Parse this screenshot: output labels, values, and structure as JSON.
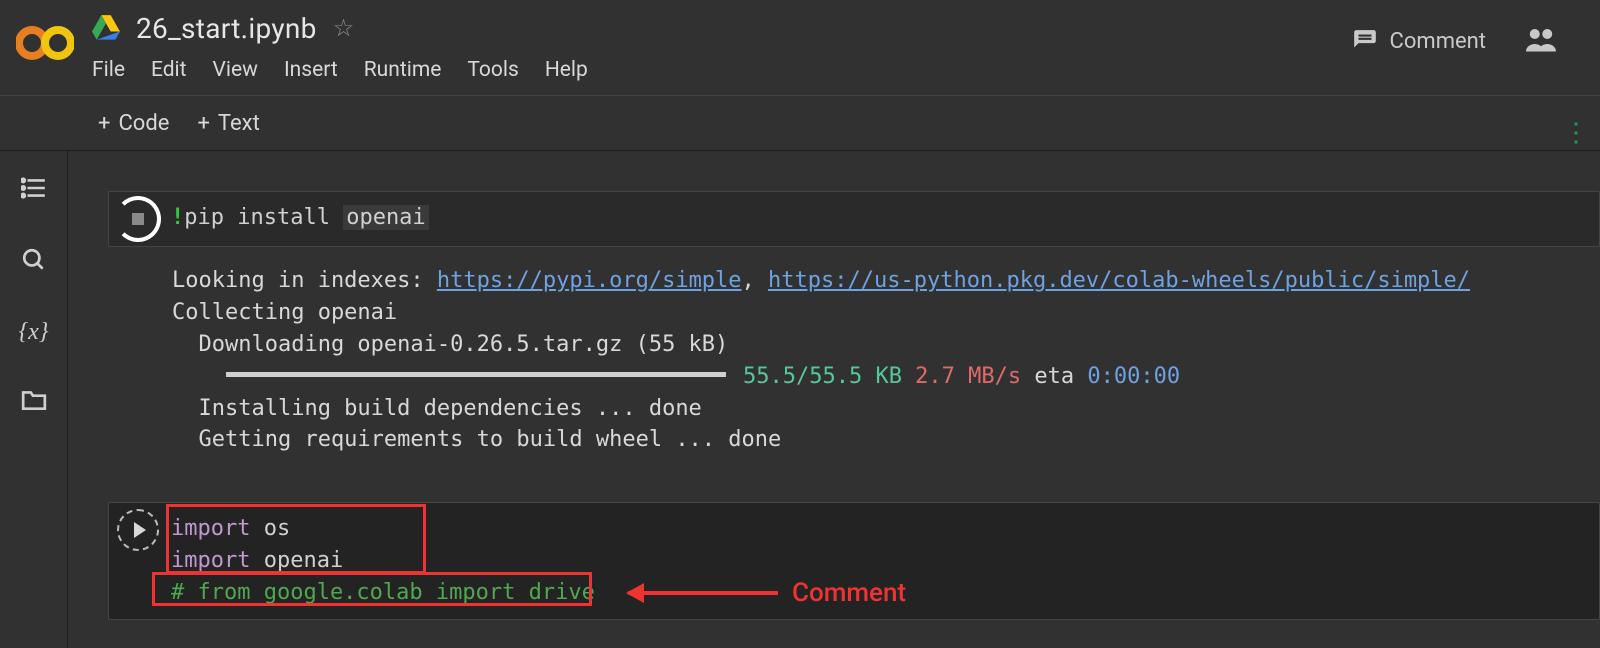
{
  "header": {
    "doc_title": "26_start.ipynb",
    "menus": {
      "file": "File",
      "edit": "Edit",
      "view": "View",
      "insert": "Insert",
      "runtime": "Runtime",
      "tools": "Tools",
      "help": "Help"
    },
    "comment_label": "Comment"
  },
  "toolbar": {
    "code_label": "Code",
    "text_label": "Text"
  },
  "cells": {
    "c1": {
      "bang": "!",
      "code_plain": "pip install ",
      "code_hl": "openai"
    },
    "c1_out": {
      "l1a": "Looking in indexes: ",
      "url1": "https://pypi.org/simple",
      "comma": ", ",
      "url2": "https://us-python.pkg.dev/colab-wheels/public/simple/",
      "l2": "Collecting openai",
      "l3": "  Downloading openai-0.26.5.tar.gz (55 kB)",
      "prog_left": " 55.5/55.5 KB",
      "prog_rate": " 2.7 MB/s",
      "prog_eta_lbl": " eta ",
      "prog_eta": "0:00:00",
      "l5": "  Installing build dependencies ... done",
      "l6": "  Getting requirements to build wheel ... done"
    },
    "c2": {
      "l1_kw": "import",
      "l1_rest": " os",
      "l2_kw": "import",
      "l2_rest": " openai",
      "l3": "# from google.colab import drive"
    }
  },
  "annotation": {
    "label": "Comment"
  }
}
